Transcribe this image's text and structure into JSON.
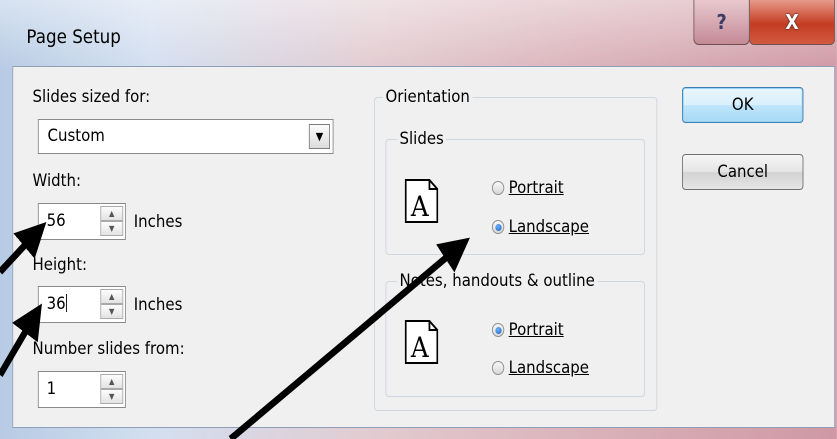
{
  "window": {
    "title": "Page Setup",
    "help_label": "?",
    "close_label": "X"
  },
  "slides_sized_for": {
    "label": "Slides sized for:",
    "value": "Custom"
  },
  "width": {
    "label": "Width:",
    "value": "56",
    "unit": "Inches"
  },
  "height": {
    "label": "Height:",
    "value": "36",
    "unit": "Inches"
  },
  "number_slides_from": {
    "label": "Number slides from:",
    "value": "1"
  },
  "orientation": {
    "label": "Orientation",
    "slides": {
      "label": "Slides",
      "portrait": "Portrait",
      "landscape": "Landscape",
      "selected": "Landscape"
    },
    "notes": {
      "label": "Notes, handouts & outline",
      "portrait": "Portrait",
      "landscape": "Landscape",
      "selected": "Portrait"
    }
  },
  "buttons": {
    "ok": "OK",
    "cancel": "Cancel"
  },
  "icons": {
    "page": "A"
  }
}
